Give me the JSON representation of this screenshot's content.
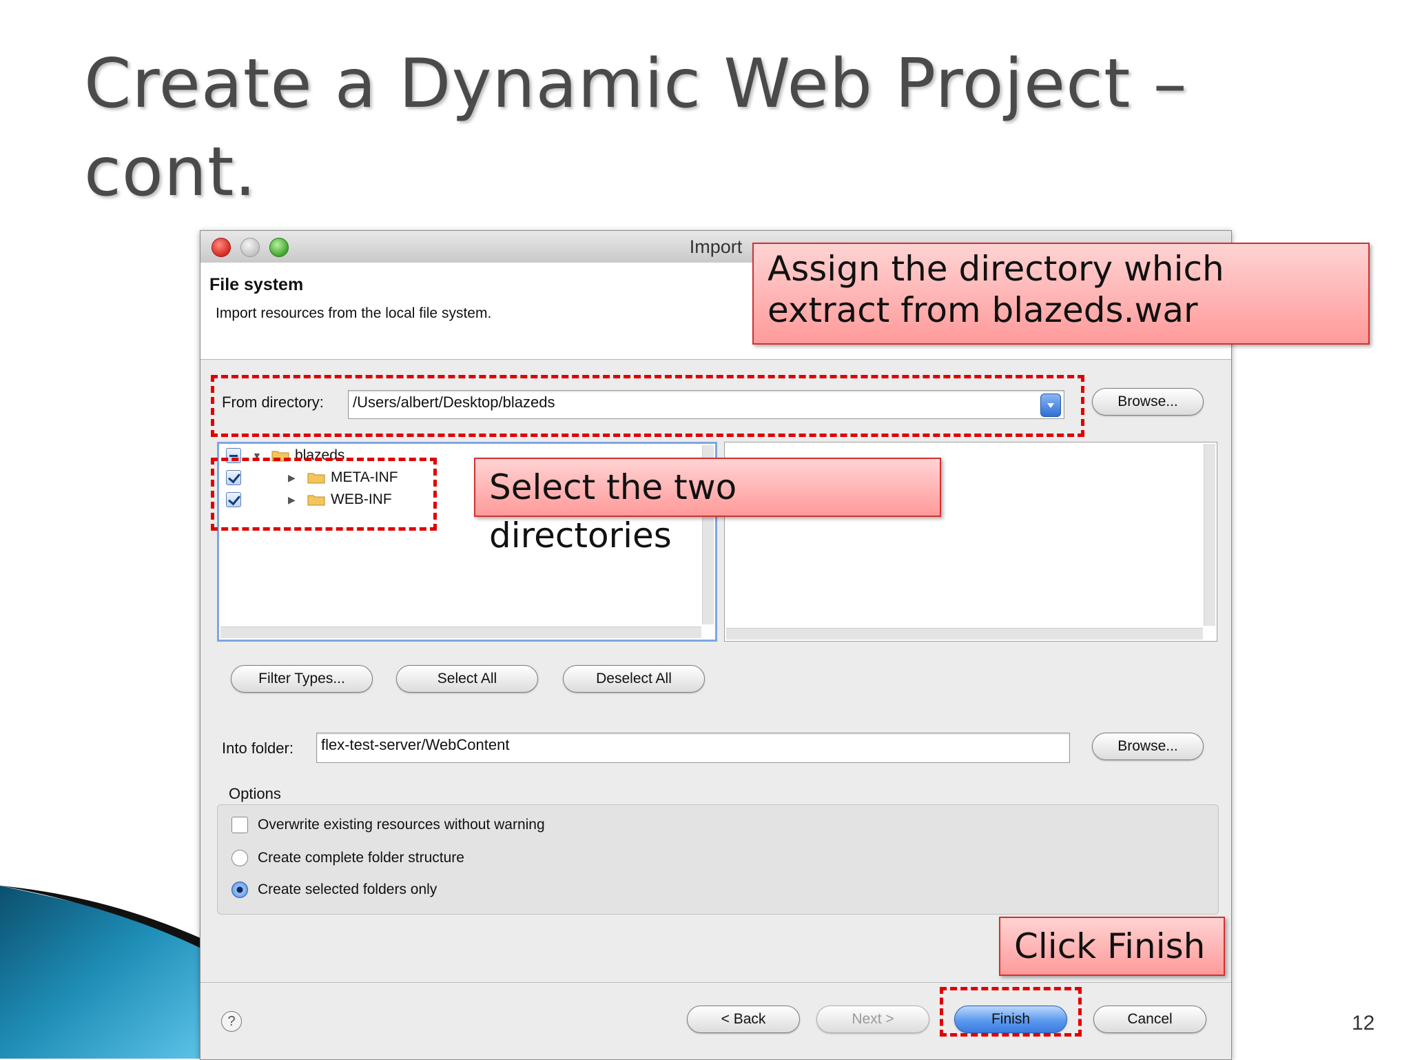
{
  "slide": {
    "title_line1": "Create a Dynamic Web Project –",
    "title_line2": "cont.",
    "page_number": "12"
  },
  "window": {
    "title": "Import",
    "header_title": "File system",
    "header_description": "Import resources from the local file system."
  },
  "from_directory": {
    "label": "From directory:",
    "value": "/Users/albert/Desktop/blazeds",
    "browse_label": "Browse..."
  },
  "tree": {
    "root": {
      "label": "blazeds",
      "check_state": "mixed",
      "icon": "folder-icon"
    },
    "children": [
      {
        "label": "META-INF",
        "checked": true,
        "icon": "folder-icon"
      },
      {
        "label": "WEB-INF",
        "checked": true,
        "icon": "folder-icon"
      }
    ]
  },
  "selection_buttons": {
    "filter_types": "Filter Types...",
    "select_all": "Select All",
    "deselect_all": "Deselect All"
  },
  "into_folder": {
    "label": "Into folder:",
    "value": "flex-test-server/WebContent",
    "browse_label": "Browse..."
  },
  "options": {
    "group_label": "Options",
    "overwrite": {
      "label": "Overwrite existing resources without warning",
      "checked": false
    },
    "complete_structure": {
      "label": "Create complete folder structure",
      "selected": false
    },
    "selected_only": {
      "label": "Create selected folders only",
      "selected": true
    }
  },
  "footer": {
    "help_icon": "?",
    "back": "< Back",
    "next": "Next >",
    "finish": "Finish",
    "cancel": "Cancel"
  },
  "callouts": {
    "directory": "Assign the directory which extract from blazeds.war",
    "select": "Select the two directories",
    "finish": "Click Finish"
  },
  "colors": {
    "callout_fill": "#ff9a9a",
    "callout_border": "#d23030",
    "highlight_dash": "#e00000",
    "default_button": "#5b99ee"
  }
}
